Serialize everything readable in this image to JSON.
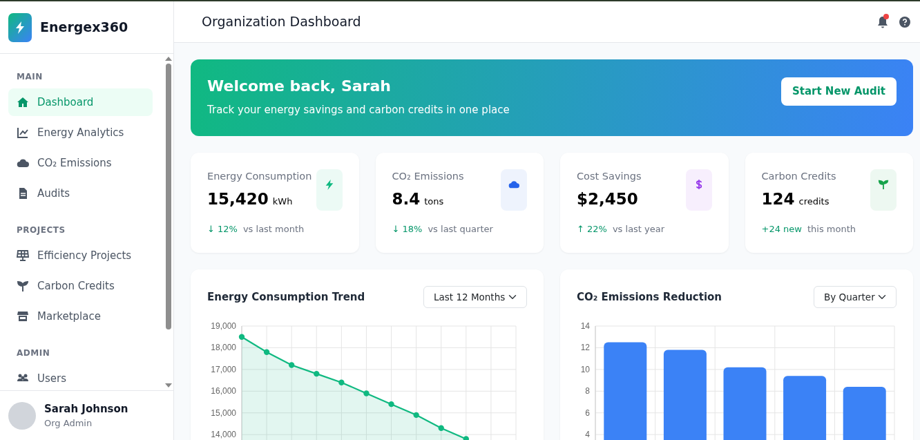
{
  "brand": {
    "name": "Energex360"
  },
  "sidebar": {
    "sections": [
      {
        "title": "MAIN",
        "items": [
          {
            "label": "Dashboard",
            "selected": true
          },
          {
            "label": "Energy Analytics",
            "selected": false
          },
          {
            "label": "CO₂ Emissions",
            "selected": false
          },
          {
            "label": "Audits",
            "selected": false
          }
        ]
      },
      {
        "title": "PROJECTS",
        "items": [
          {
            "label": "Efficiency Projects",
            "selected": false
          },
          {
            "label": "Carbon Credits",
            "selected": false
          },
          {
            "label": "Marketplace",
            "selected": false
          }
        ]
      },
      {
        "title": "ADMIN",
        "items": [
          {
            "label": "Users",
            "selected": false
          }
        ]
      }
    ]
  },
  "user": {
    "name": "Sarah Johnson",
    "role": "Org Admin"
  },
  "header": {
    "title": "Organization Dashboard",
    "notifications": true
  },
  "banner": {
    "title": "Welcome back, Sarah",
    "subtitle": "Track your energy savings and carbon credits in one place",
    "button": "Start New Audit"
  },
  "stats": [
    {
      "label": "Energy Consumption",
      "value": "15,420",
      "unit": "kWh",
      "color": "#10b981",
      "change": "↓ 12%",
      "note": "vs last month"
    },
    {
      "label": "CO₂ Emissions",
      "value": "8.4",
      "unit": "tons",
      "color": "#2563eb",
      "change": "↓ 18%",
      "note": "vs last quarter"
    },
    {
      "label": "Cost Savings",
      "value": "$2,450",
      "color": "#9333ea",
      "change": "↑ 22%",
      "note": "vs last year"
    },
    {
      "label": "Carbon Credits",
      "value": "124",
      "unit": "credits",
      "color": "#16a34a",
      "change": "+24 new",
      "note": "this month"
    }
  ],
  "charts": [
    {
      "title": "Energy Consumption Trend",
      "filter": "Last 12 Months",
      "chart_data": {
        "type": "area",
        "grid": true,
        "ylim": [
          12000,
          19000
        ],
        "yticks": [
          {
            "value": 14000,
            "label": "14,000"
          },
          {
            "value": 15000,
            "label": "15,000"
          },
          {
            "value": 16000,
            "label": "16,000"
          },
          {
            "value": 17000,
            "label": "17,000"
          },
          {
            "value": 18000,
            "label": "18,000"
          },
          {
            "value": 19000,
            "label": "19,000"
          }
        ],
        "series": [
          {
            "color": "#10b981",
            "values": [
              18500,
              17800,
              17200,
              16800,
              16400,
              15900,
              15400,
              14900,
              14300,
              13800,
              null,
              null
            ]
          }
        ]
      }
    },
    {
      "title": "CO₂ Emissions Reduction",
      "filter": "By Quarter",
      "chart_data": {
        "type": "bar",
        "grid": true,
        "ylim": [
          0,
          14
        ],
        "yticks": [
          4,
          6,
          8,
          10,
          12,
          14
        ],
        "series": [
          {
            "color": "#3b82f6",
            "values": [
              12.5,
              11.8,
              10.2,
              9.4,
              8.4
            ]
          }
        ]
      }
    }
  ]
}
